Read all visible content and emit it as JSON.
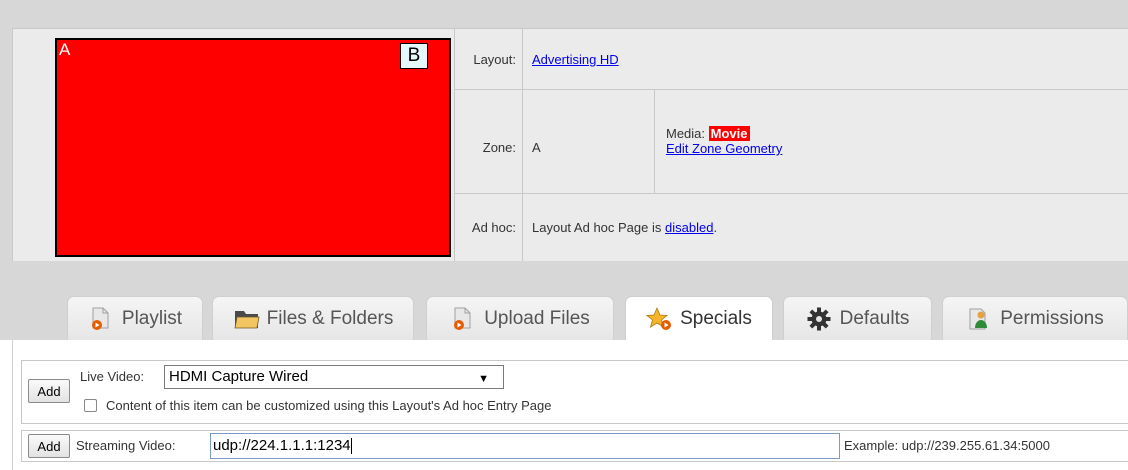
{
  "preview": {
    "zone_a": "A",
    "zone_b": "B",
    "colors": {
      "zone_a": "#ff0000",
      "zone_b": "#e6f7fb"
    }
  },
  "info": {
    "layout_label": "Layout:",
    "layout_value": "Advertising HD",
    "zone_label": "Zone:",
    "zone_value": "A",
    "media_label": "Media:",
    "media_value": "Movie",
    "edit_zone_link": "Edit Zone Geometry",
    "adhoc_label": "Ad hoc:",
    "adhoc_text_prefix": "Layout Ad hoc Page is",
    "adhoc_link": "disabled",
    "adhoc_text_suffix": "."
  },
  "tabs": [
    {
      "label": "Playlist",
      "icon": "playlist-icon",
      "active": false
    },
    {
      "label": "Files & Folders",
      "icon": "folder-icon",
      "active": false
    },
    {
      "label": "Upload Files",
      "icon": "upload-icon",
      "active": false
    },
    {
      "label": "Specials",
      "icon": "star-icon",
      "active": true
    },
    {
      "label": "Defaults",
      "icon": "gear-icon",
      "active": false
    },
    {
      "label": "Permissions",
      "icon": "permissions-icon",
      "active": false
    }
  ],
  "specials": {
    "live": {
      "add_label": "Add",
      "label": "Live Video:",
      "selected": "HDMI Capture Wired",
      "checkbox_label": "Content of this item can be customized using this Layout's Ad hoc Entry Page",
      "checked": false
    },
    "streaming": {
      "add_label": "Add",
      "label": "Streaming Video:",
      "value": "udp://224.1.1.1:1234",
      "example": "Example: udp://239.255.61.34:5000"
    }
  }
}
